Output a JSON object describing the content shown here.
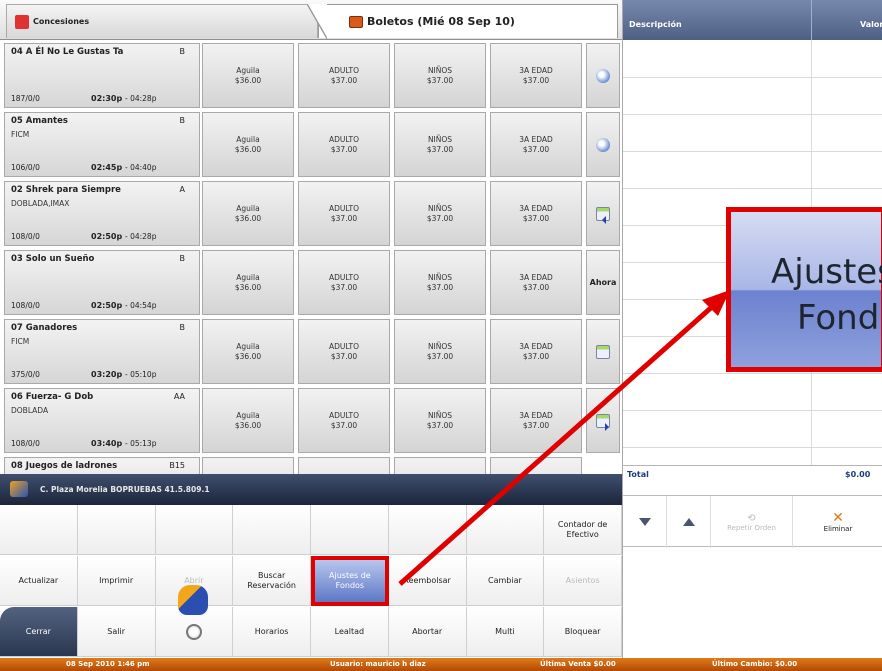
{
  "tabs": {
    "concesiones": "Concesiones",
    "boletos": "Boletos (Mié 08 Sep 10)"
  },
  "movies": [
    {
      "title": "04  A Él No Le Gustas Ta",
      "rating": "B",
      "subtitle": "",
      "count": "187/0/0",
      "time": "02:30p",
      "end": "- 04:28p",
      "prices": [
        [
          "Aguila",
          "$36.00"
        ],
        [
          "ADULTO",
          "$37.00"
        ],
        [
          "NIÑOS",
          "$37.00"
        ],
        [
          "3A EDAD",
          "$37.00"
        ]
      ],
      "action": "clock-icon"
    },
    {
      "title": "05  Amantes",
      "rating": "B",
      "subtitle": "FICM",
      "count": "106/0/0",
      "time": "02:45p",
      "end": "- 04:40p",
      "prices": [
        [
          "Aguila",
          "$36.00"
        ],
        [
          "ADULTO",
          "$37.00"
        ],
        [
          "NIÑOS",
          "$37.00"
        ],
        [
          "3A EDAD",
          "$37.00"
        ]
      ],
      "action": "clock-icon"
    },
    {
      "title": "02  Shrek para Siempre",
      "rating": "A",
      "subtitle": "DOBLADA,IMAX",
      "count": "108/0/0",
      "time": "02:50p",
      "end": "- 04:28p",
      "prices": [
        [
          "Aguila",
          "$36.00"
        ],
        [
          "ADULTO",
          "$37.00"
        ],
        [
          "NIÑOS",
          "$37.00"
        ],
        [
          "3A EDAD",
          "$37.00"
        ]
      ],
      "action": "calendar-prev-icon"
    },
    {
      "title": "03  Solo un Sueño",
      "rating": "B",
      "subtitle": "",
      "count": "108/0/0",
      "time": "02:50p",
      "end": "- 04:54p",
      "prices": [
        [
          "Aguila",
          "$36.00"
        ],
        [
          "ADULTO",
          "$37.00"
        ],
        [
          "NIÑOS",
          "$37.00"
        ],
        [
          "3A EDAD",
          "$37.00"
        ]
      ],
      "action": "Ahora"
    },
    {
      "title": "07  Ganadores",
      "rating": "B",
      "subtitle": "FICM",
      "count": "375/0/0",
      "time": "03:20p",
      "end": "- 05:10p",
      "prices": [
        [
          "Aguila",
          "$36.00"
        ],
        [
          "ADULTO",
          "$37.00"
        ],
        [
          "NIÑOS",
          "$37.00"
        ],
        [
          "3A EDAD",
          "$37.00"
        ]
      ],
      "action": "calendar-icon"
    },
    {
      "title": "06  Fuerza- G Dob",
      "rating": "AA",
      "subtitle": "DOBLADA",
      "count": "108/0/0",
      "time": "03:40p",
      "end": "- 05:13p",
      "prices": [
        [
          "Aguila",
          "$36.00"
        ],
        [
          "ADULTO",
          "$37.00"
        ],
        [
          "NIÑOS",
          "$37.00"
        ],
        [
          "3A EDAD",
          "$37.00"
        ]
      ],
      "action": "calendar-next-icon"
    },
    {
      "title": "08  Juegos de ladrones",
      "rating": "B15",
      "subtitle": "",
      "count": "",
      "time": "",
      "end": "",
      "prices": [],
      "action": ""
    }
  ],
  "status_bar": "C. Plaza Morelia   BOPRUEBAS   41.5.809.1",
  "keypad": {
    "row1": [
      "",
      "",
      "",
      "",
      "",
      "",
      "",
      "Contador de Efectivo"
    ],
    "row2": [
      "Actualizar",
      "Imprimir",
      "Abrir",
      "Buscar Reservación",
      "Ajustes de Fondos",
      "Reembolsar",
      "Cambiar",
      "Asientos"
    ],
    "row3": [
      "Cerrar",
      "Salir",
      "",
      "Horarios",
      "Lealtad",
      "Abortar",
      "Multi",
      "Bloquear"
    ]
  },
  "order": {
    "col_desc": "Descripción",
    "col_val": "Valor",
    "total_label": "Total",
    "total_value": "$0.00",
    "repeat_label": "Repetir Orden",
    "delete_label": "Eliminar"
  },
  "zoom": {
    "line1": "Ajustes",
    "line2": "Fond"
  },
  "footer": {
    "datetime": "08 Sep 2010 1:46 pm",
    "user": "Usuario:  mauricio h diaz",
    "last_sale": "Última Venta  $0.00",
    "last_change": "Último Cambio:  $0.00"
  },
  "colors": {
    "highlight": "#e00000",
    "header": "#4d5f84",
    "footer": "#c85a10"
  }
}
